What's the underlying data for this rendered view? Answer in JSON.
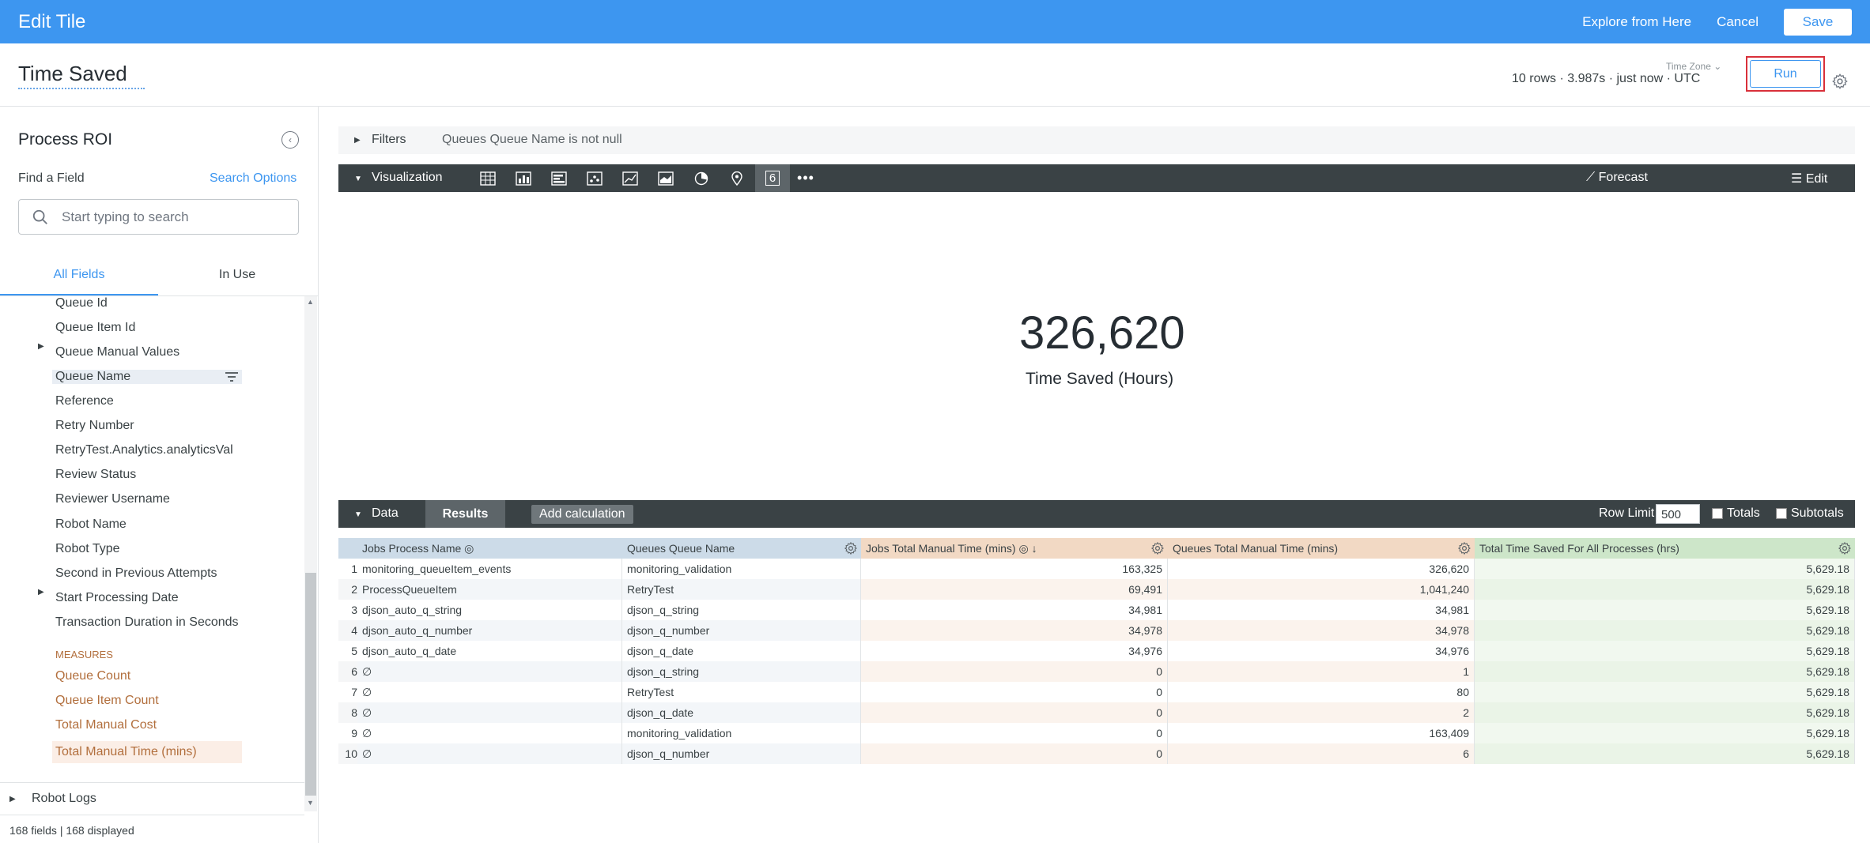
{
  "topbar": {
    "title": "Edit Tile",
    "explore_label": "Explore from Here",
    "cancel_label": "Cancel",
    "save_label": "Save",
    "bg_color": "#3d96f0"
  },
  "tile": {
    "title": "Time Saved",
    "meta": "10 rows · 3.987s · just now · UTC",
    "timezone_label": "Time Zone",
    "run_label": "Run"
  },
  "sidebar": {
    "explore_name": "Process ROI",
    "find_label": "Find a Field",
    "search_options_label": "Search Options",
    "search_placeholder": "Start typing to search",
    "tabs": [
      "All Fields",
      "In Use"
    ],
    "dimensions": [
      {
        "label": "Queue Id"
      },
      {
        "label": "Queue Item Id"
      },
      {
        "label": "Queue Manual Values",
        "expandable": true
      },
      {
        "label": "Queue Name",
        "highlighted": true,
        "filtered": true
      },
      {
        "label": "Reference"
      },
      {
        "label": "Retry Number"
      },
      {
        "label": "RetryTest.Analytics.analyticsVal"
      },
      {
        "label": "Review Status"
      },
      {
        "label": "Reviewer Username"
      },
      {
        "label": "Robot Name"
      },
      {
        "label": "Robot Type"
      },
      {
        "label": "Second in Previous Attempts"
      },
      {
        "label": "Start Processing Date",
        "expandable": true
      },
      {
        "label": "Transaction Duration in Seconds"
      }
    ],
    "measures_label": "MEASURES",
    "measures": [
      {
        "label": "Queue Count"
      },
      {
        "label": "Queue Item Count"
      },
      {
        "label": "Total Manual Cost"
      },
      {
        "label": "Total Manual Time (mins)",
        "highlighted": true
      }
    ],
    "robot_logs_label": "Robot Logs",
    "field_count": "168 fields | 168 displayed"
  },
  "filters": {
    "label": "Filters",
    "expression": "Queues Queue Name is not null"
  },
  "visualization": {
    "label": "Visualization",
    "icons": [
      "table-icon",
      "column-chart-icon",
      "bar-chart-icon",
      "scatter-icon",
      "line-chart-icon",
      "area-chart-icon",
      "pie-chart-icon",
      "map-pin-icon",
      "single-value-icon",
      "more-icon"
    ],
    "single_value_glyph": "6",
    "forecast_label": "Forecast",
    "edit_label": "Edit",
    "value": "326,620",
    "value_label": "Time Saved (Hours)"
  },
  "data": {
    "label": "Data",
    "results_label": "Results",
    "add_calc_label": "Add calculation",
    "row_limit_label": "Row Limit",
    "row_limit": "500",
    "totals_label": "Totals",
    "subtotals_label": "Subtotals",
    "columns": [
      {
        "label": "Jobs Process Name",
        "color": "#ccdbe8",
        "cell": "#ffffff"
      },
      {
        "label": "Queues Queue Name",
        "color": "#ccdbe8",
        "cell": "#ffffff"
      },
      {
        "label": "Jobs Total Manual Time (mins)",
        "color": "#f2d9c4",
        "cell": "#ffffff"
      },
      {
        "label": "Queues Total Manual Time (mins)",
        "color": "#f2d9c4",
        "cell": "#ffffff"
      },
      {
        "label": "Total Time Saved For All Processes (hrs)",
        "color": "#cde6c9",
        "cell": "#f1f8ef"
      }
    ],
    "rows": [
      [
        "1",
        "monitoring_queueItem_events",
        "monitoring_validation",
        "163,325",
        "326,620",
        "5,629.18"
      ],
      [
        "2",
        "ProcessQueueItem",
        "RetryTest",
        "69,491",
        "1,041,240",
        "5,629.18"
      ],
      [
        "3",
        "djson_auto_q_string",
        "djson_q_string",
        "34,981",
        "34,981",
        "5,629.18"
      ],
      [
        "4",
        "djson_auto_q_number",
        "djson_q_number",
        "34,978",
        "34,978",
        "5,629.18"
      ],
      [
        "5",
        "djson_auto_q_date",
        "djson_q_date",
        "34,976",
        "34,976",
        "5,629.18"
      ],
      [
        "6",
        "∅",
        "djson_q_string",
        "0",
        "1",
        "5,629.18"
      ],
      [
        "7",
        "∅",
        "RetryTest",
        "0",
        "80",
        "5,629.18"
      ],
      [
        "8",
        "∅",
        "djson_q_date",
        "0",
        "2",
        "5,629.18"
      ],
      [
        "9",
        "∅",
        "monitoring_validation",
        "0",
        "163,409",
        "5,629.18"
      ],
      [
        "10",
        "∅",
        "djson_q_number",
        "0",
        "6",
        "5,629.18"
      ]
    ]
  }
}
